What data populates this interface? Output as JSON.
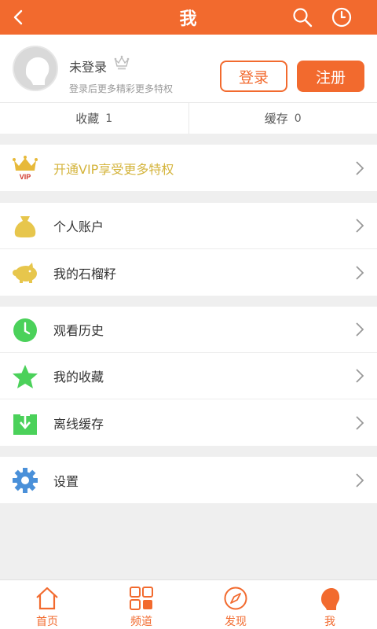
{
  "header": {
    "title": "我"
  },
  "profile": {
    "name": "未登录",
    "hint": "登录后更多精彩更多特权",
    "login_label": "登录",
    "register_label": "注册"
  },
  "stats": [
    {
      "label": "收藏",
      "count": "1"
    },
    {
      "label": "缓存",
      "count": "0"
    }
  ],
  "vip": {
    "label": "开通VIP享受更多特权",
    "badge": "VIP"
  },
  "menu": {
    "account": "个人账户",
    "seeds": "我的石榴籽",
    "history": "观看历史",
    "favorites": "我的收藏",
    "offline": "离线缓存",
    "settings": "设置"
  },
  "tabs": [
    {
      "label": "首页"
    },
    {
      "label": "频道"
    },
    {
      "label": "发现"
    },
    {
      "label": "我"
    }
  ],
  "colors": {
    "brand": "#f26a2e",
    "vip_gold": "#d4b43c",
    "green": "#4bd15a",
    "blue": "#4a90d9"
  }
}
